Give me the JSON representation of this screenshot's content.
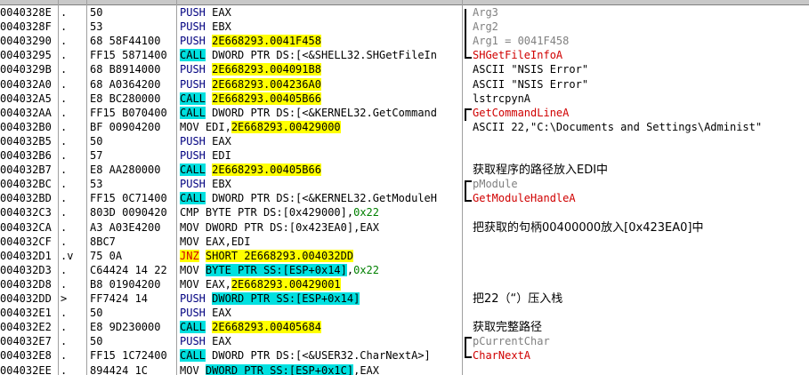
{
  "header": {
    "c1": "",
    "c2": "",
    "c3": "",
    "c4": ""
  },
  "rows": [
    {
      "addr": "0040328E",
      "mark": ".",
      "hex": "50",
      "mn": "PUSH",
      "mnc": "m-push",
      "a1": "EAX",
      "a1c": "",
      "a2": "",
      "a2c": "",
      "a3": "",
      "a3c": "",
      "cm": "Arg3",
      "cmc": "gray mono"
    },
    {
      "addr": "0040328F",
      "mark": ".",
      "hex": "53",
      "mn": "PUSH",
      "mnc": "m-push",
      "a1": "EBX",
      "a1c": "",
      "a2": "",
      "a2c": "",
      "a3": "",
      "a3c": "",
      "cm": "Arg2",
      "cmc": "gray mono"
    },
    {
      "addr": "00403290",
      "mark": ".",
      "hex": "68 58F44100",
      "mn": "PUSH",
      "mnc": "m-push",
      "a1": "2E668293.0041F458",
      "a1c": "hl-yellow",
      "a2": "",
      "a2c": "",
      "a3": "",
      "a3c": "",
      "cm": "Arg1 = 0041F458",
      "cmc": "gray mono"
    },
    {
      "addr": "00403295",
      "mark": ".",
      "hex": "FF15 5871400",
      "mn": "CALL",
      "mnc": "m-call",
      "a1": "DWORD PTR DS:[<&SHELL32.SHGetFileIn",
      "a1c": "",
      "a2": "",
      "a2c": "",
      "a3": "",
      "a3c": "",
      "cm": "SHGetFileInfoA",
      "cmc": "red mono"
    },
    {
      "addr": "0040329B",
      "mark": ".",
      "hex": "68 B8914000",
      "mn": "PUSH",
      "mnc": "m-push",
      "a1": "2E668293.004091B8",
      "a1c": "hl-yellow",
      "a2": "",
      "a2c": "",
      "a3": "",
      "a3c": "",
      "cm": "ASCII \"NSIS Error\"",
      "cmc": "mono"
    },
    {
      "addr": "004032A0",
      "mark": ".",
      "hex": "68 A0364200",
      "mn": "PUSH",
      "mnc": "m-push",
      "a1": "2E668293.004236A0",
      "a1c": "hl-yellow",
      "a2": "",
      "a2c": "",
      "a3": "",
      "a3c": "",
      "cm": "ASCII \"NSIS Error\"",
      "cmc": "mono"
    },
    {
      "addr": "004032A5",
      "mark": ".",
      "hex": "E8 BC280000",
      "mn": "CALL",
      "mnc": "m-call",
      "a1": "2E668293.00405B66",
      "a1c": "hl-yellow",
      "a2": "",
      "a2c": "",
      "a3": "",
      "a3c": "",
      "cm": "lstrcpynA",
      "cmc": "mono"
    },
    {
      "addr": "004032AA",
      "mark": ".",
      "hex": "FF15 B070400",
      "mn": "CALL",
      "mnc": "m-call",
      "a1": "DWORD PTR DS:[<&KERNEL32.GetCommand",
      "a1c": "",
      "a2": "",
      "a2c": "",
      "a3": "",
      "a3c": "",
      "cm": "GetCommandLineA",
      "cmc": "red mono"
    },
    {
      "addr": "004032B0",
      "mark": ".",
      "hex": "BF 00904200",
      "mn": "MOV",
      "mnc": "m-mov",
      "a1": "EDI,",
      "a1c": "",
      "a2": "2E668293.00429000",
      "a2c": "hl-yellow",
      "a3": "",
      "a3c": "",
      "cm": "ASCII 22,\"C:\\Documents and Settings\\Administ\"",
      "cmc": "mono"
    },
    {
      "addr": "004032B5",
      "mark": ".",
      "hex": "50",
      "mn": "PUSH",
      "mnc": "m-push",
      "a1": "EAX",
      "a1c": "",
      "a2": "",
      "a2c": "",
      "a3": "",
      "a3c": "",
      "cm": "",
      "cmc": ""
    },
    {
      "addr": "004032B6",
      "mark": ".",
      "hex": "57",
      "mn": "PUSH",
      "mnc": "m-push",
      "a1": "EDI",
      "a1c": "",
      "a2": "",
      "a2c": "",
      "a3": "",
      "a3c": "",
      "cm": "",
      "cmc": ""
    },
    {
      "addr": "004032B7",
      "mark": ".",
      "hex": "E8 AA280000",
      "mn": "CALL",
      "mnc": "m-call",
      "a1": "2E668293.00405B66",
      "a1c": "hl-yellow",
      "a2": "",
      "a2c": "",
      "a3": "",
      "a3c": "",
      "cm": "获取程序的路径放入EDI中",
      "cmc": ""
    },
    {
      "addr": "004032BC",
      "mark": ".",
      "hex": "53",
      "mn": "PUSH",
      "mnc": "m-push",
      "a1": "EBX",
      "a1c": "",
      "a2": "",
      "a2c": "",
      "a3": "",
      "a3c": "",
      "cm": "pModule",
      "cmc": "gray mono"
    },
    {
      "addr": "004032BD",
      "mark": ".",
      "hex": "FF15 0C71400",
      "mn": "CALL",
      "mnc": "m-call",
      "a1": "DWORD PTR DS:[<&KERNEL32.GetModuleH",
      "a1c": "",
      "a2": "",
      "a2c": "",
      "a3": "",
      "a3c": "",
      "cm": "GetModuleHandleA",
      "cmc": "red mono"
    },
    {
      "addr": "004032C3",
      "mark": ".",
      "hex": "803D 0090420",
      "mn": "CMP",
      "mnc": "m-cmp",
      "a1": "BYTE PTR DS:[0x429000],",
      "a1c": "",
      "a2": "0x22",
      "a2c": "green",
      "a3": "",
      "a3c": "",
      "cm": "",
      "cmc": ""
    },
    {
      "addr": "004032CA",
      "mark": ".",
      "hex": "A3 A03E4200",
      "mn": "MOV",
      "mnc": "m-mov",
      "a1": "DWORD PTR DS:[0x423EA0],EAX",
      "a1c": "",
      "a2": "",
      "a2c": "",
      "a3": "",
      "a3c": "",
      "cm": "把获取的句柄00400000放入[0x423EA0]中",
      "cmc": ""
    },
    {
      "addr": "004032CF",
      "mark": ".",
      "hex": "8BC7",
      "mn": "MOV",
      "mnc": "m-mov",
      "a1": "EAX,EDI",
      "a1c": "",
      "a2": "",
      "a2c": "",
      "a3": "",
      "a3c": "",
      "cm": "",
      "cmc": ""
    },
    {
      "addr": "004032D1",
      "mark": ".v",
      "hex": "75 0A",
      "mn": "JNZ",
      "mnc": "m-jnz",
      "a1": "SHORT 2E668293.004032DD",
      "a1c": "hl-yellow",
      "a2": "",
      "a2c": "",
      "a3": "",
      "a3c": "",
      "cm": "",
      "cmc": ""
    },
    {
      "addr": "004032D3",
      "mark": ".",
      "hex": "C64424 14 22",
      "mn": "MOV",
      "mnc": "m-mov",
      "a1": "BYTE PTR SS:[ESP+0x14]",
      "a1c": "hl-cyan",
      "a2": ",",
      "a2c": "",
      "a3": "0x22",
      "a3c": "green",
      "cm": "",
      "cmc": ""
    },
    {
      "addr": "004032D8",
      "mark": ".",
      "hex": "B8 01904200",
      "mn": "MOV",
      "mnc": "m-mov",
      "a1": "EAX,",
      "a1c": "",
      "a2": "2E668293.00429001",
      "a2c": "hl-yellow",
      "a3": "",
      "a3c": "",
      "cm": "",
      "cmc": ""
    },
    {
      "addr": "004032DD",
      "mark": ">",
      "hex": "FF7424 14",
      "mn": "PUSH",
      "mnc": "m-push",
      "a1": "DWORD PTR SS:[ESP+0x14]",
      "a1c": "hl-cyan",
      "a2": "",
      "a2c": "",
      "a3": "",
      "a3c": "",
      "cm": "把22（“）压入栈",
      "cmc": ""
    },
    {
      "addr": "004032E1",
      "mark": ".",
      "hex": "50",
      "mn": "PUSH",
      "mnc": "m-push",
      "a1": "EAX",
      "a1c": "",
      "a2": "",
      "a2c": "",
      "a3": "",
      "a3c": "",
      "cm": "",
      "cmc": ""
    },
    {
      "addr": "004032E2",
      "mark": ".",
      "hex": "E8 9D230000",
      "mn": "CALL",
      "mnc": "m-call",
      "a1": "2E668293.00405684",
      "a1c": "hl-yellow",
      "a2": "",
      "a2c": "",
      "a3": "",
      "a3c": "",
      "cm": "获取完整路径",
      "cmc": ""
    },
    {
      "addr": "004032E7",
      "mark": ".",
      "hex": "50",
      "mn": "PUSH",
      "mnc": "m-push",
      "a1": "EAX",
      "a1c": "",
      "a2": "",
      "a2c": "",
      "a3": "",
      "a3c": "",
      "cm": "pCurrentChar",
      "cmc": "gray mono"
    },
    {
      "addr": "004032E8",
      "mark": ".",
      "hex": "FF15 1C72400",
      "mn": "CALL",
      "mnc": "m-call",
      "a1": "DWORD PTR DS:[<&USER32.CharNextA>]",
      "a1c": "",
      "a2": "",
      "a2c": "",
      "a3": "",
      "a3c": "",
      "cm": "CharNextA",
      "cmc": "red mono"
    },
    {
      "addr": "004032EE",
      "mark": ".",
      "hex": "894424 1C",
      "mn": "MOV",
      "mnc": "m-mov",
      "a1": "DWORD PTR SS:[ESP+0x1C]",
      "a1c": "hl-cyan",
      "a2": ",EAX",
      "a2c": "",
      "a3": "",
      "a3c": "",
      "cm": "",
      "cmc": ""
    }
  ]
}
